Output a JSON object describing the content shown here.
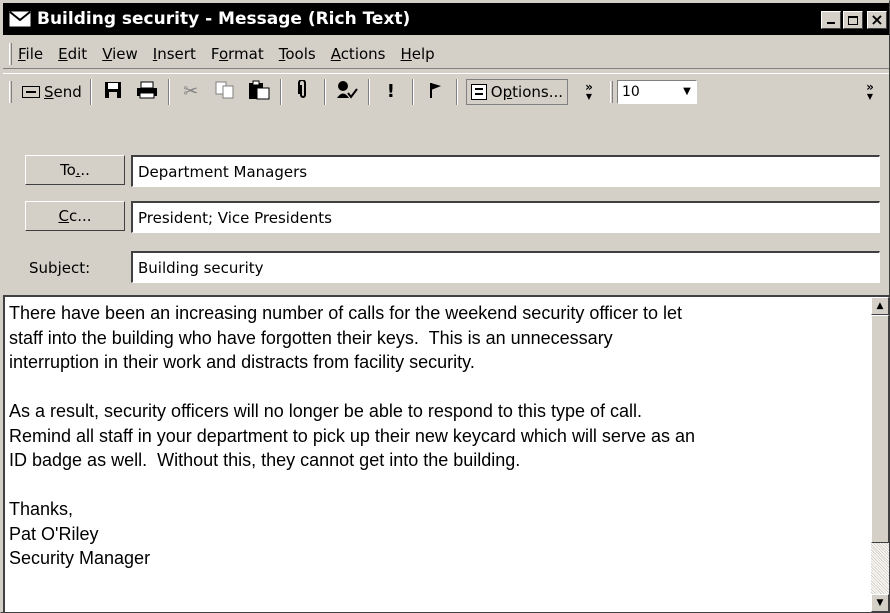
{
  "window": {
    "title": "Building security - Message (Rich Text)",
    "caption_buttons": {
      "minimize": "_",
      "maximize": "□",
      "close": "×"
    }
  },
  "menu": {
    "items": [
      {
        "label": "File",
        "accel": "F"
      },
      {
        "label": "Edit",
        "accel": "E"
      },
      {
        "label": "View",
        "accel": "V"
      },
      {
        "label": "Insert",
        "accel": "I"
      },
      {
        "label": "Format",
        "accel": "o"
      },
      {
        "label": "Tools",
        "accel": "T"
      },
      {
        "label": "Actions",
        "accel": "A"
      },
      {
        "label": "Help",
        "accel": "H"
      }
    ]
  },
  "toolbar": {
    "send_label": "Send",
    "options_label": "Options...",
    "overflow_label": "»",
    "font_size": "10",
    "icons": [
      "save-icon",
      "print-icon",
      "cut-icon",
      "copy-icon",
      "paste-icon",
      "attach-icon",
      "check-names-icon",
      "importance-high-icon",
      "flag-icon"
    ]
  },
  "header": {
    "to_button": "To...",
    "to_value": "Department Managers",
    "cc_button": "Cc...",
    "cc_value": "President; Vice Presidents",
    "subject_label": "Subject:",
    "subject_value": "Building security"
  },
  "message": {
    "body": "There have been an increasing number of calls for the weekend security officer to let\nstaff into the building who have forgotten their keys.  This is an unnecessary\ninterruption in their work and distracts from facility security.\n\nAs a result, security officers will no longer be able to respond to this type of call.\nRemind all staff in your department to pick up their new keycard which will serve as an\nID badge as well.  Without this, they cannot get into the building.\n\nThanks,\nPat O'Riley\nSecurity Manager"
  }
}
